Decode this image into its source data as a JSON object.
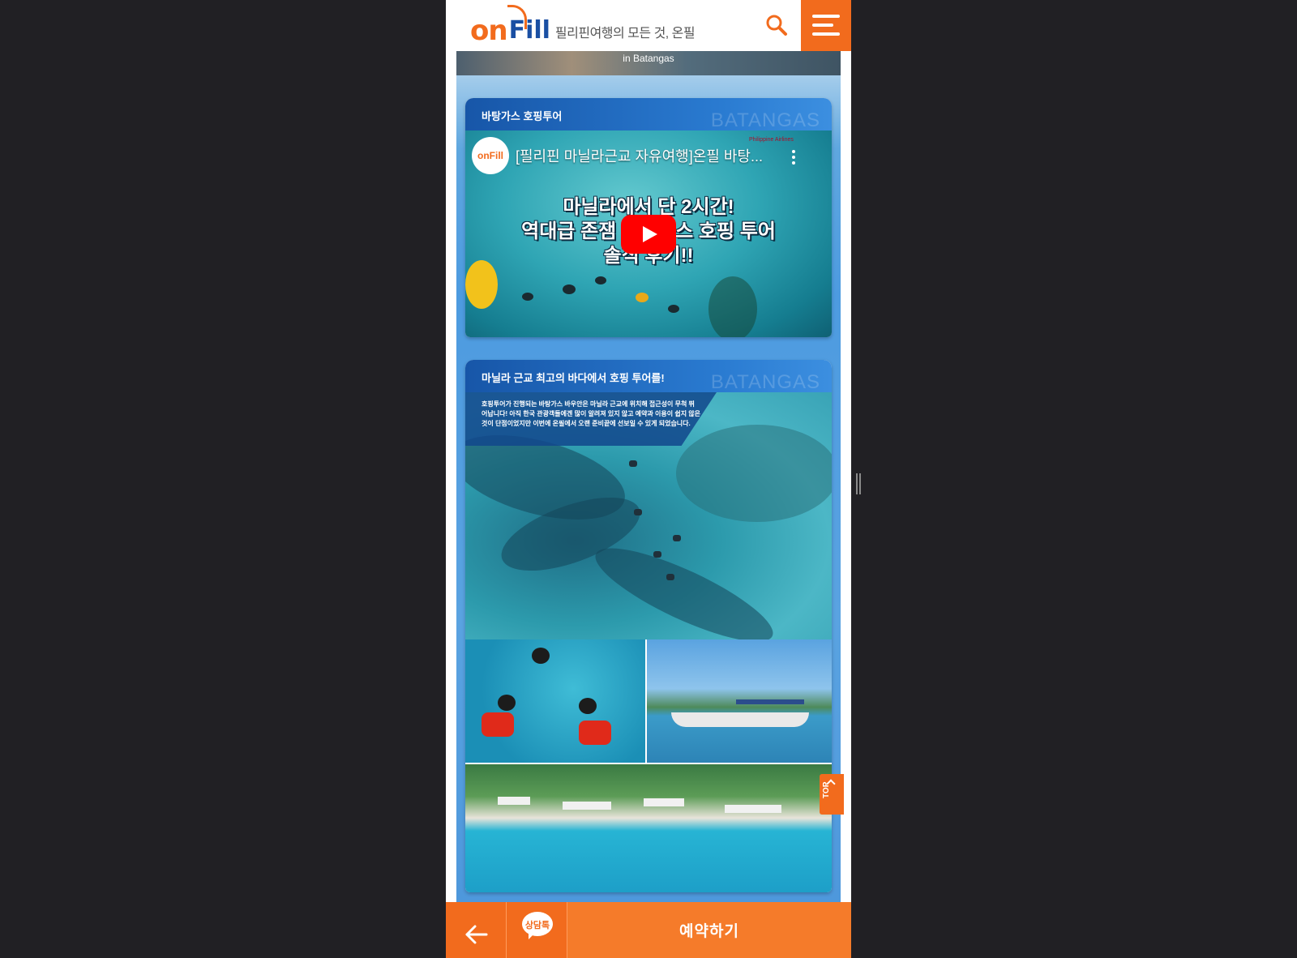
{
  "header": {
    "logo_on": "on",
    "logo_fill": "Fill",
    "tagline": "필리핀여행의 모든 것, 온필",
    "search_icon": "search-icon",
    "menu_icon": "hamburger-menu-icon"
  },
  "hero_strip": {
    "caption": "in Batangas"
  },
  "video_card": {
    "title": "바탕가스 호핑투어",
    "watermark": "BATANGAS",
    "video": {
      "channel_logo": "onFill",
      "title": "[필리핀 마닐라근교 자유여행]온필 바탕...",
      "sponsor": "Philippine Airlines",
      "overlay_line1": "마닐라에서 단 2시간!",
      "overlay_line2": "역대급 존잼 바탕가스 호핑 투어",
      "overlay_line3": "솔직 후기!!"
    }
  },
  "gallery_card": {
    "title": "마닐라 근교 최고의 바다에서 호핑 투어를!",
    "watermark": "BATANGAS",
    "description": "호핑투어가 진행되는 바탕가스 바우안은 마닐라 근교에 위치해 접근성이 무척 뛰어납니다! 아직 한국 관광객들에겐 많이 알려져 있지 않고 예약과 이용이 쉽지 않은 것이 단점이었지만 이번에 온필에서 오랜 준비끝에 선보일 수 있게 되었습니다."
  },
  "floating": {
    "top_label": "TOP"
  },
  "bottom_bar": {
    "back_icon": "arrow-left-icon",
    "chat_label": "상담톡",
    "reserve_label": "예약하기"
  },
  "colors": {
    "brand_orange": "#f26b1d",
    "brand_blue": "#1a4fa3",
    "page_bg": "#212024"
  }
}
